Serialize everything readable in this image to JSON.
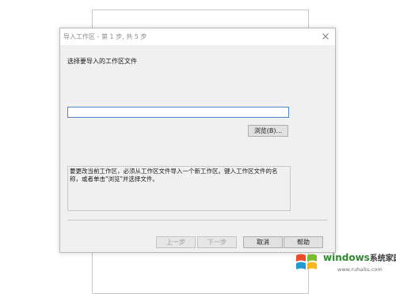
{
  "dialog": {
    "title": "导入工作区 - 第 1 步, 共 5 步",
    "close_icon": "close-icon",
    "section_label": "选择要导入的工作区文件",
    "file_path_value": "",
    "browse_label": "浏览(B)...",
    "description": "要更改当前工作区，必须从工作区文件导入一个新工作区。键入工作区文件的名称，或者单击\"浏览\"并选择文件。",
    "buttons": {
      "prev": "上一步",
      "next": "下一步",
      "cancel": "取消",
      "help": "帮助"
    }
  },
  "watermark": {
    "brand": "windows",
    "brand_cn": "系统家园",
    "url": "www.ruhaitu.com"
  },
  "colors": {
    "dialog_bg": "#f0f0f0",
    "input_border": "#4a86c8",
    "disabled_text": "#a0a0a0",
    "watermark_green": "#2f8a2f"
  }
}
